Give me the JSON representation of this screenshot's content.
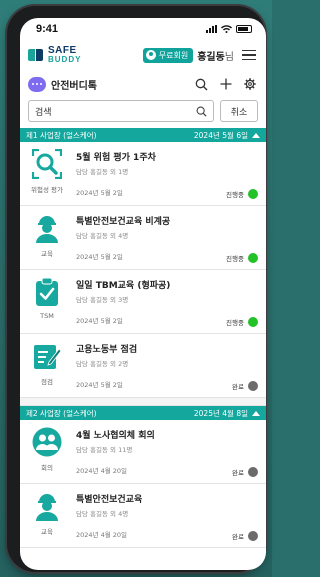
{
  "status_bar": {
    "time": "9:41"
  },
  "header": {
    "logo_line1": "SAFE",
    "logo_line2": "BUDDY",
    "member_badge": "무료회원",
    "user_name": "홍길동",
    "user_suffix": "님"
  },
  "toolbar": {
    "brand_name": "안전버디톡",
    "icons": [
      "search-icon",
      "plus-icon",
      "gear-icon"
    ]
  },
  "search": {
    "value": "검색",
    "cancel_label": "취소"
  },
  "colors": {
    "accent": "#14a79e",
    "in_progress": "#24c229",
    "done": "#6b6b6b"
  },
  "sites": [
    {
      "name": "제1 사업장  (얼스케어)",
      "date": "2024년 5월 6일",
      "items": [
        {
          "icon": "risk-assessment-icon",
          "category": "위험성 평가",
          "title": "5월 위험 평가 1주차",
          "sub": "담당 홍길동 외 1명",
          "date": "2024년 5월 2일",
          "status": "진행중",
          "status_color": "green"
        },
        {
          "icon": "worker-icon",
          "category": "교육",
          "title": "특별안전보건교육 비계공",
          "sub": "담당 홍길동 외 4명",
          "date": "2024년 5월 2일",
          "status": "진행중",
          "status_color": "green"
        },
        {
          "icon": "clipboard-icon",
          "category": "TSM",
          "title": "일일 TBM교육 (형파공)",
          "sub": "담당 홍길동 외 3명",
          "date": "2024년 5월 2일",
          "status": "진행중",
          "status_color": "green"
        },
        {
          "icon": "inspection-icon",
          "category": "점검",
          "title": "고용노동부 점검",
          "sub": "담당 홍길동 외 2명",
          "date": "2024년 5월 2일",
          "status": "완료",
          "status_color": "gray"
        }
      ]
    },
    {
      "name": "제2 사업장  (얼스케어)",
      "date": "2025년 4월 8일",
      "items": [
        {
          "icon": "meeting-icon",
          "category": "회의",
          "title": "4월 노사협의체 회의",
          "sub": "담당 홍길동 외 11명",
          "date": "2024년 4월 20일",
          "status": "완료",
          "status_color": "gray"
        },
        {
          "icon": "worker-icon",
          "category": "교육",
          "title": "특별안전보건교육",
          "sub": "담당 홍길동 외 4명",
          "date": "2024년 4월 20일",
          "status": "완료",
          "status_color": "gray"
        }
      ]
    }
  ]
}
